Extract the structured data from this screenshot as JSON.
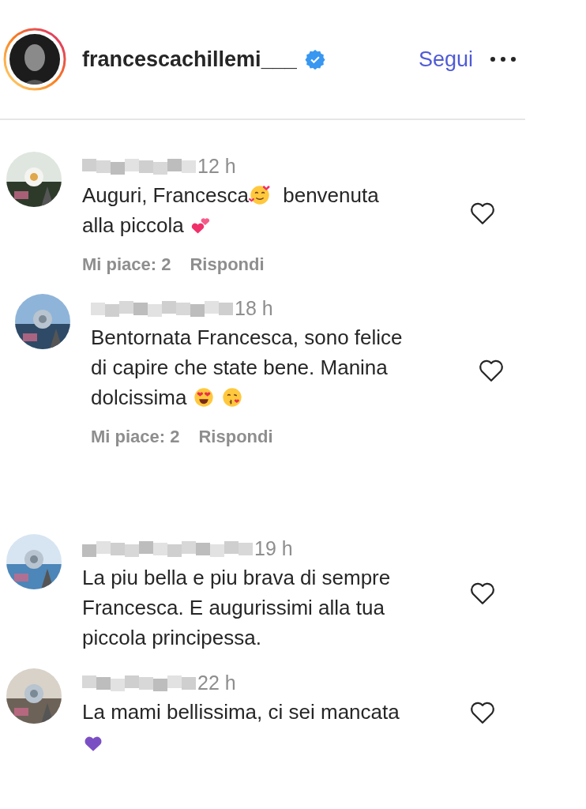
{
  "header": {
    "username": "francescachillemi___",
    "verified": true,
    "follow_label": "Segui"
  },
  "comments": [
    {
      "time": "12 h",
      "lines": [
        [
          {
            "kind": "text",
            "text": "Auguri, Francesca"
          },
          {
            "kind": "hearts_face"
          },
          {
            "kind": "text",
            "text": " benvenuta"
          }
        ],
        [
          {
            "kind": "text",
            "text": "alla piccola "
          },
          {
            "kind": "two_hearts"
          }
        ]
      ],
      "likes": "Mi piace: 2",
      "reply": "Rispondi",
      "children": [
        {
          "time": "18 h",
          "lines": [
            [
              {
                "kind": "text",
                "text": "Bentornata Francesca, sono felice"
              }
            ],
            [
              {
                "kind": "text",
                "text": "di capire che state bene. Manina"
              }
            ],
            [
              {
                "kind": "text",
                "text": "dolcissima "
              },
              {
                "kind": "heart_eyes"
              },
              {
                "kind": "kiss"
              }
            ]
          ],
          "likes": "Mi piace: 2",
          "reply": "Rispondi"
        }
      ]
    },
    {
      "time": "19 h",
      "lines": [
        [
          {
            "kind": "text",
            "text": "La piu bella e piu brava di sempre"
          }
        ],
        [
          {
            "kind": "text",
            "text": "Francesca. E augurissimi alla tua"
          }
        ],
        [
          {
            "kind": "text",
            "text": "piccola principessa."
          }
        ]
      ]
    },
    {
      "time": "22 h",
      "lines": [
        [
          {
            "kind": "text",
            "text": "La mami bellissima, ci sei mancata"
          }
        ],
        [
          {
            "kind": "purple_heart"
          }
        ]
      ]
    }
  ]
}
